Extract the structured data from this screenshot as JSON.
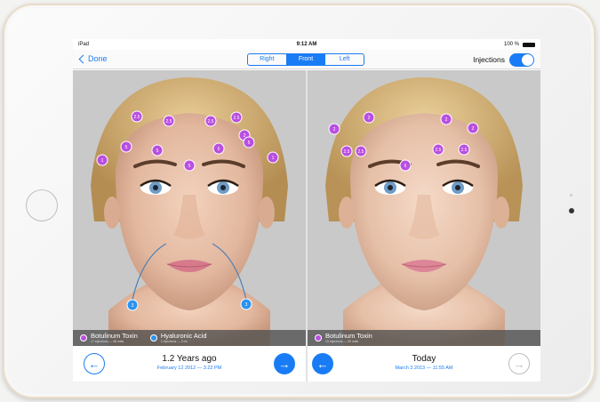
{
  "status": {
    "carrier": "iPad",
    "time": "9:12 AM",
    "battery": "100 %"
  },
  "nav": {
    "back_label": "Done",
    "segments": [
      "Right",
      "Front",
      "Left"
    ],
    "active_segment": "Front",
    "injections_label": "Injections",
    "injections_on": true
  },
  "colors": {
    "accent": "#1a7cf5",
    "botox": "#b94fe0",
    "filler": "#2b93ee"
  },
  "left_panel": {
    "markers": [
      "2.5",
      "2.5",
      "2.5",
      "2.5",
      "2",
      "5",
      "5",
      "5",
      "5",
      "1",
      "1",
      "5",
      "3",
      "3"
    ],
    "legend": [
      {
        "name": "Botulinum Toxin",
        "sub": "17 injections — 48 units",
        "color": "#b94fe0"
      },
      {
        "name": "Hyaluronic Acid",
        "sub": "2 injections — 3 ml",
        "color": "#2b93ee"
      }
    ],
    "title": "1.2 Years ago",
    "subtitle": "February 12 2012 — 3:22 PM"
  },
  "right_panel": {
    "markers": [
      "2",
      "2",
      "2",
      "2",
      "2.5",
      "2.5",
      "2.5",
      "2.5",
      "5"
    ],
    "legend": [
      {
        "name": "Botulinum Toxin",
        "sub": "15 injections — 39 units",
        "color": "#b94fe0"
      }
    ],
    "title": "Today",
    "subtitle": "March 3 2013 — 11:55 AM"
  },
  "icons": {
    "back": "chevron-left-icon",
    "prev": "arrow-left-icon",
    "next": "arrow-right-icon"
  }
}
